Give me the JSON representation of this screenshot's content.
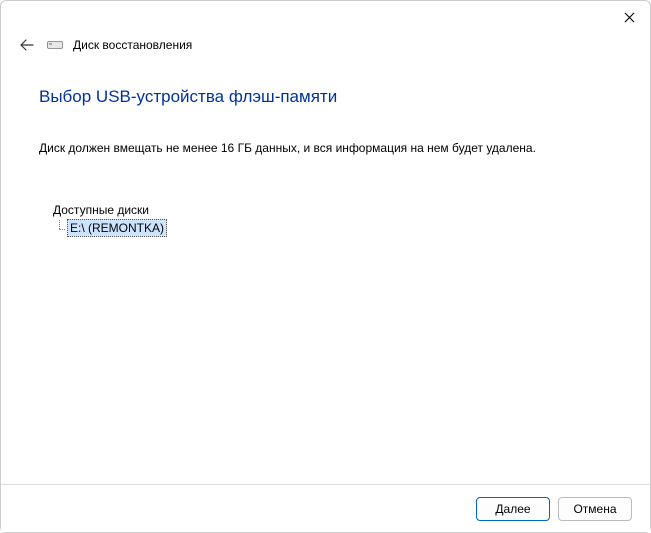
{
  "window": {
    "title": "Диск восстановления"
  },
  "page": {
    "heading": "Выбор USB-устройства флэш-памяти",
    "subtext": "Диск должен вмещать не менее 16 ГБ данных, и вся информация на нем будет удалена."
  },
  "drives": {
    "label": "Доступные диски",
    "items": [
      {
        "text": "E:\\ (REMONTKA)",
        "selected": true
      }
    ]
  },
  "footer": {
    "next_label": "Далее",
    "cancel_label": "Отмена"
  }
}
